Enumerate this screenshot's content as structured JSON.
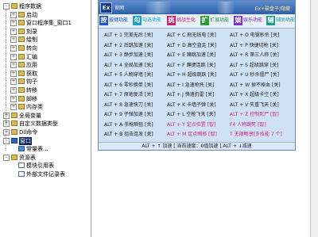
{
  "tree": {
    "items": [
      {
        "label": "程序数据",
        "level": 0,
        "toggle": "-",
        "icon": "folder-icon",
        "iconClass": "",
        "selected": false
      },
      {
        "label": "启动",
        "level": 1,
        "toggle": "+",
        "icon": "folder-icon",
        "iconClass": "",
        "selected": false
      },
      {
        "label": "窗口程序集_窗口1",
        "level": 1,
        "toggle": "+",
        "icon": "folder-icon",
        "iconClass": "",
        "selected": false
      },
      {
        "label": "刻录",
        "level": 1,
        "toggle": "+",
        "icon": "folder-icon",
        "iconClass": "",
        "selected": false
      },
      {
        "label": "绘制",
        "level": 1,
        "toggle": "+",
        "icon": "folder-icon",
        "iconClass": "",
        "selected": false
      },
      {
        "label": "转向",
        "level": 1,
        "toggle": "+",
        "icon": "folder-icon",
        "iconClass": "",
        "selected": false
      },
      {
        "label": "汇编",
        "level": 1,
        "toggle": "+",
        "icon": "folder-icon",
        "iconClass": "",
        "selected": false
      },
      {
        "label": "应用",
        "level": 1,
        "toggle": "+",
        "icon": "folder-icon",
        "iconClass": "",
        "selected": false
      },
      {
        "label": "获取",
        "level": 1,
        "toggle": "+",
        "icon": "folder-icon",
        "iconClass": "",
        "selected": false
      },
      {
        "label": "钩子",
        "level": 1,
        "toggle": "+",
        "icon": "folder-icon",
        "iconClass": "",
        "selected": false
      },
      {
        "label": "转移",
        "level": 1,
        "toggle": "+",
        "icon": "folder-icon",
        "iconClass": "",
        "selected": false
      },
      {
        "label": "脚移",
        "level": 1,
        "toggle": "+",
        "icon": "folder-icon",
        "iconClass": "",
        "selected": false
      },
      {
        "label": "内存类",
        "level": 1,
        "toggle": "+",
        "icon": "folder-icon",
        "iconClass": "",
        "selected": false
      },
      {
        "label": "全局变量",
        "level": 0,
        "toggle": "+",
        "icon": "folder-icon",
        "iconClass": "",
        "selected": false
      },
      {
        "label": "自定义数据类型",
        "level": 0,
        "toggle": "+",
        "icon": "folder-icon",
        "iconClass": "",
        "selected": false
      },
      {
        "label": "Dll命令",
        "level": 0,
        "toggle": "+",
        "icon": "folder-icon",
        "iconClass": "",
        "selected": false
      },
      {
        "label": "窗口",
        "level": 0,
        "toggle": "-",
        "icon": "window-icon",
        "iconClass": "win",
        "selected": true
      },
      {
        "label": "常量表...",
        "level": 1,
        "toggle": "",
        "icon": "table-icon",
        "iconClass": "blue",
        "selected": false
      },
      {
        "label": "资源表",
        "level": 0,
        "toggle": "-",
        "icon": "folder-icon",
        "iconClass": "",
        "selected": false
      },
      {
        "label": "模块引用表",
        "level": 1,
        "toggle": "",
        "icon": "document-icon",
        "iconClass": "doc",
        "selected": false
      },
      {
        "label": "外部文件记录表",
        "level": 1,
        "toggle": "",
        "icon": "document-icon",
        "iconClass": "doc",
        "selected": false
      }
    ]
  },
  "panel": {
    "logo": "Ex",
    "top_left": "官网",
    "top_right": "Ex+破盘子/隐藏",
    "tabs": [
      {
        "key": "按",
        "text": "按键功能",
        "key_color": "#1f52c8",
        "text_color": "#1f52c8"
      },
      {
        "key": "勾",
        "text": "勾选功能",
        "key_color": "#19a3c8",
        "text_color": "#19a3c8"
      },
      {
        "key": "挑",
        "text": "挑战生化",
        "key_color": "#c81f6a",
        "text_color": "#c81f6a"
      },
      {
        "key": "扩",
        "text": "扩展功能",
        "key_color": "#2e9a3a",
        "text_color": "#2e9a3a"
      },
      {
        "key": "娱",
        "text": "娱乐功能",
        "key_color": "#7a2ec8",
        "text_color": "#7a2ec8"
      },
      {
        "key": "辅",
        "text": "辅助功能",
        "key_color": "#1f9a8a",
        "text_color": "#1f9a8a"
      }
    ],
    "rows": [
      [
        {
          "text": "ALT + 1 完美无后 [关]",
          "hl": false
        },
        {
          "text": "ALT + C 刷无线电 [关]",
          "hl": false
        },
        {
          "text": "ALT + O 电锯秒杀 [关]",
          "hl": false
        }
      ],
      [
        {
          "text": "ALT + 2 后跳加速 [关]",
          "hl": false
        },
        {
          "text": "ALT + D 高空直走 [关]",
          "hl": false
        },
        {
          "text": "ALT + P 快捷切枪 [关]",
          "hl": false
        }
      ],
      [
        {
          "text": "ALT + 3 静步加速 [关]",
          "hl": false
        },
        {
          "text": "ALT + E 蹲跳加速 [关]",
          "hl": false
        },
        {
          "text": "ALT + R 第三人称 [关]",
          "hl": false
        }
      ],
      [
        {
          "text": "ALT + 4 全局加速 [关]",
          "hl": false
        },
        {
          "text": "ALT + F 蹲键连跳 [关]",
          "hl": false
        },
        {
          "text": "ALT + S 超级跳穿 [关]",
          "hl": false
        }
      ],
      [
        {
          "text": "ALT + 5 人物穿墙 [关]",
          "hl": false
        },
        {
          "text": "ALT + H 超级跳跃 [关]",
          "hl": false
        },
        {
          "text": "ALT + U 秒杀僵尸 [关]",
          "hl": false
        }
      ],
      [
        {
          "text": "ALT + 6 零秒换单 [关]",
          "hl": false
        },
        {
          "text": "ALT + I 急速枪托 [关]",
          "hl": false
        },
        {
          "text": "ALT + W 掉不掉血 [关]",
          "hl": false
        }
      ],
      [
        {
          "text": "ALT + 7 原地复活 [关]",
          "hl": false
        },
        {
          "text": "ALT + J 快速扔雷 [关]",
          "hl": false
        },
        {
          "text": "ALT + X 超级卡空 [关]",
          "hl": false
        }
      ],
      [
        {
          "text": "ALT + 8 急速快刀 [关]",
          "hl": false
        },
        {
          "text": "ALT + K 卡墙子弹 [关]",
          "hl": false
        },
        {
          "text": "ALT + V 失重飞天 [关]",
          "hl": false
        }
      ],
      [
        {
          "text": "ALT + 9 子弹加速 [关]",
          "hl": false
        },
        {
          "text": "ALT + L 空枪飞天 [关]",
          "hl": false
        },
        {
          "text": "ALT + Z 控制死尸 [智]",
          "hl": true
        }
      ],
      [
        {
          "text": "ALT + A 手枪瞬狙 [关]",
          "hl": false
        },
        {
          "text": "ALT + Y 定点位置 [智]",
          "hl": true
        },
        {
          "text": "F4 人物跳死 [智]",
          "hl": true
        }
      ],
      [
        {
          "text": "ALT + B 狙击连发 [关]",
          "hl": false
        },
        {
          "text": "ALT + M 定点瞬移 [智]",
          "hl": true
        },
        {
          "text": "T 无限畅享[多技能 7 个]",
          "hl": true
        }
      ]
    ],
    "footer": "ALT + ↑ 加速 [ 当前速度：0值加速 ] ALT + ↓减速"
  }
}
